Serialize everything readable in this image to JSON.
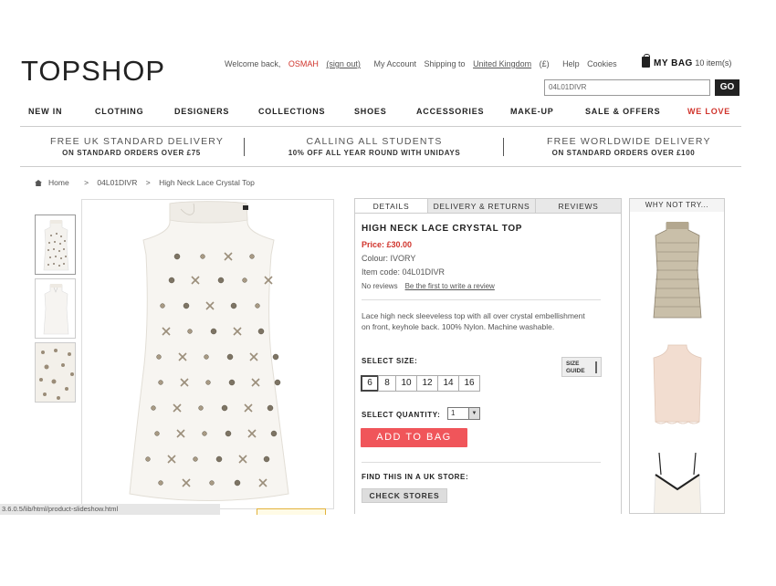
{
  "header": {
    "logo": "TOPSHOP",
    "welcome": "Welcome back,",
    "user": "OSMAH",
    "sign_out": "(sign out)",
    "my_account": "My Account",
    "shipping_to": "Shipping to",
    "country": "United Kingdom",
    "currency": "(£)",
    "help": "Help",
    "cookies": "Cookies",
    "bag_label": "MY BAG",
    "bag_count": "10 item(s)",
    "search_value": "04L01DIVR",
    "go_label": "GO"
  },
  "nav": [
    "NEW IN",
    "CLOTHING",
    "DESIGNERS",
    "COLLECTIONS",
    "SHOES",
    "ACCESSORIES",
    "MAKE-UP",
    "SALE & OFFERS",
    "WE LOVE"
  ],
  "promos": [
    {
      "line1": "FREE UK STANDARD DELIVERY",
      "line2": "ON STANDARD ORDERS OVER £75"
    },
    {
      "line1": "CALLING ALL STUDENTS",
      "line2": "10% OFF ALL YEAR ROUND WITH UNIDAYS"
    },
    {
      "line1": "FREE WORLDWIDE DELIVERY",
      "line2": "ON STANDARD ORDERS OVER £100"
    }
  ],
  "breadcrumb": {
    "home": "Home",
    "sep": ">",
    "code": "04L01DIVR",
    "current": "High Neck Lace Crystal Top"
  },
  "tabs": [
    "DETAILS",
    "DELIVERY & RETURNS",
    "REVIEWS"
  ],
  "product": {
    "title": "HIGH NECK LACE CRYSTAL TOP",
    "price": "Price: £30.00",
    "colour": "Colour: IVORY",
    "item_code": "Item code: 04L01DIVR",
    "no_reviews": "No reviews",
    "first_review": "Be the first to write a review",
    "description": "Lace high neck sleeveless top with all over crystal embellishment on front, keyhole back. 100% Nylon. Machine washable.",
    "select_size": "SELECT SIZE:",
    "size_guide_1": "SIZE",
    "size_guide_2": "GUIDE",
    "sizes": [
      "6",
      "8",
      "10",
      "12",
      "14",
      "16"
    ],
    "select_quantity": "SELECT QUANTITY:",
    "quantity": "1",
    "add_to_bag": "ADD TO BAG",
    "find_in_store": "FIND THIS IN A UK STORE:",
    "check_stores": "CHECK STORES"
  },
  "why_not_try": "WHY NOT TRY...",
  "status_url": "3.6.0.5/lib/html/product-slideshow.html",
  "colors": {
    "accent_red": "#d0342c",
    "add_to_bag": "#f0555a"
  }
}
